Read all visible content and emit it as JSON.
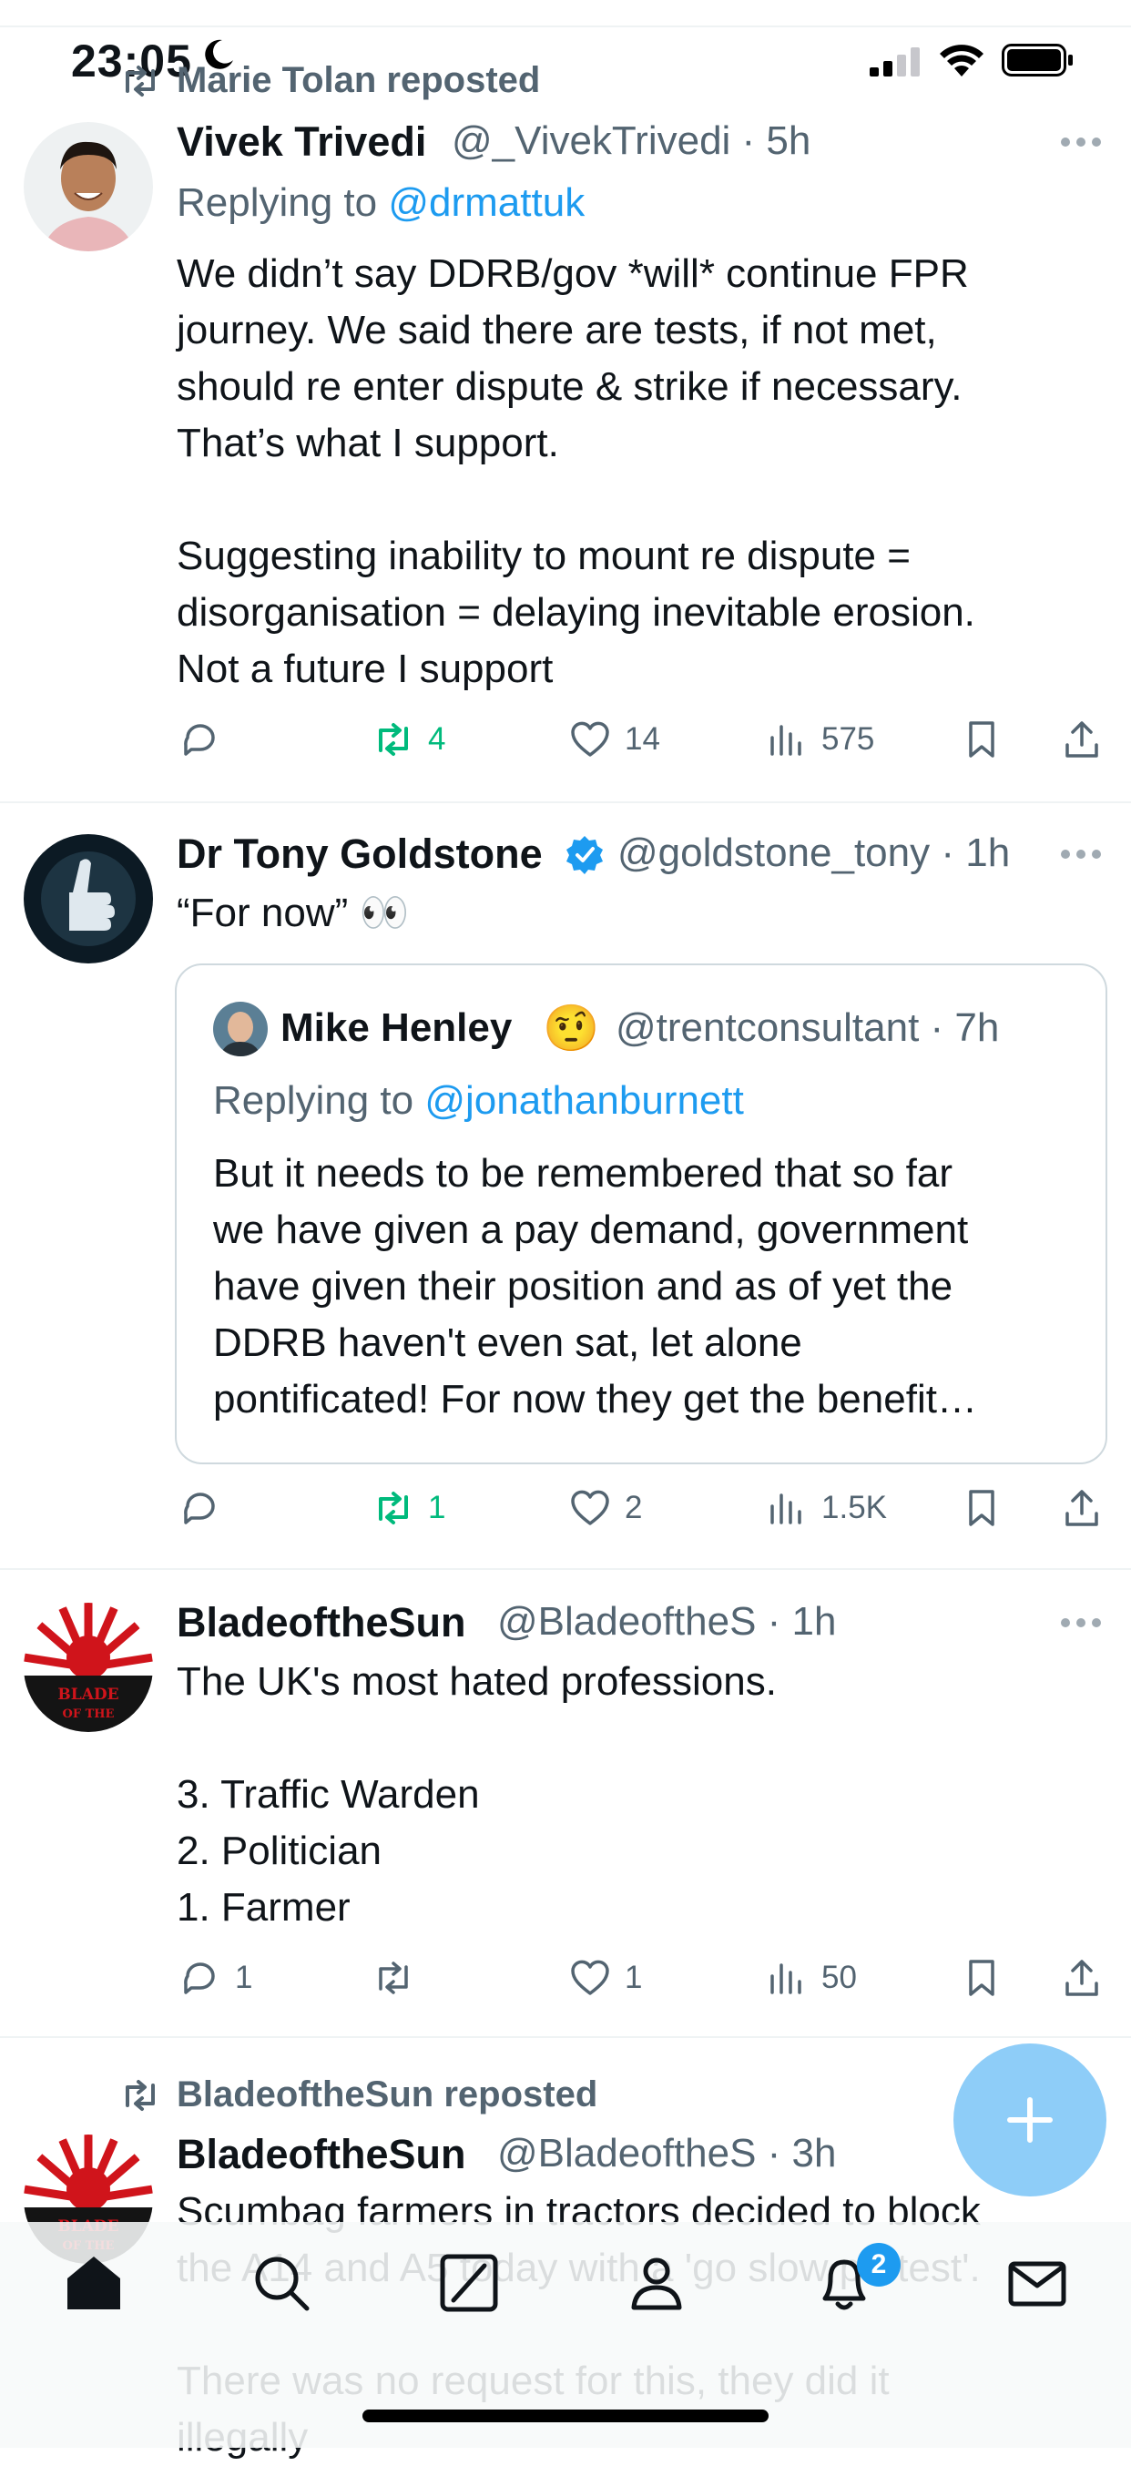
{
  "status_bar": {
    "time": "23:05"
  },
  "tweets": [
    {
      "repost_by": "Marie Tolan reposted",
      "name": "Vivek Trivedi",
      "handle": "@_VivekTrivedi · 5h",
      "replying_prefix": "Replying to ",
      "replying_handle": "@drmattuk",
      "body": "We didn’t say DDRB/gov *will* continue FPR\njourney. We said there are tests, if not met,\nshould re enter dispute & strike if necessary.\nThat’s what I support.\n\nSuggesting inability to mount re dispute =\ndisorganisation = delaying inevitable erosion.\nNot a future I support",
      "replies": "",
      "reposts": "4",
      "likes": "14",
      "views": "575"
    },
    {
      "name": "Dr Tony Goldstone",
      "handle": "@goldstone_tony · 1h",
      "body": "“For now” 👀",
      "quote": {
        "name": "Mike Henley",
        "emoji": "🤨",
        "handle": "@trentconsultant · 7h",
        "replying_prefix": "Replying to ",
        "replying_handle": "@jonathanburnett",
        "body": "But it needs to be remembered that so far\nwe have given a pay demand, government\nhave given their position and as of yet the\nDDRB haven't even sat, let alone\npontificated! For now they get the benefit…"
      },
      "replies": "",
      "reposts": "1",
      "likes": "2",
      "views": "1.5K"
    },
    {
      "name": "BladeoftheSun",
      "handle": "@BladeoftheS · 1h",
      "body": "The UK's most hated professions.\n\n3. Traffic Warden\n2. Politician\n1. Farmer",
      "replies": "1",
      "reposts": "",
      "likes": "1",
      "views": "50"
    },
    {
      "repost_by": "BladeoftheSun reposted",
      "name": "BladeoftheSun",
      "handle": "@BladeoftheS · 3h",
      "body": "Scumbag farmers in tractors decided to block\nthe A14 and A5 today with a 'go slow protest'.\n\nThere was no request for this, they did it\nillegally"
    }
  ],
  "tab_bar": {
    "notification_badge": "2"
  },
  "colors": {
    "accent": "#1d9bf0",
    "repost_green": "#00ba7c",
    "muted": "#536471",
    "verified": "#1d9bf0"
  }
}
